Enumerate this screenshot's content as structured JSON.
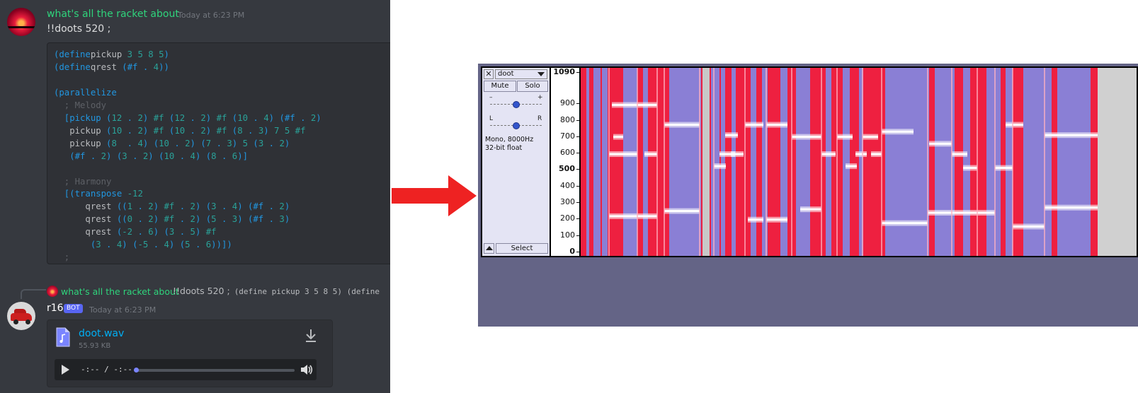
{
  "discord": {
    "message1": {
      "username": "what's all the racket about",
      "timestamp": "Today at 6:23 PM",
      "text": "!!doots 520 ;",
      "code_lines": [
        [
          [
            "kw",
            "(define"
          ],
          [
            "",
            "pickup "
          ],
          [
            "nm",
            "3 5 8 5"
          ],
          [
            "kw",
            ")"
          ]
        ],
        [
          [
            "kw",
            "(define"
          ],
          [
            "",
            "qrest "
          ],
          [
            "kw",
            "(#f . "
          ],
          [
            "nm",
            "4"
          ],
          [
            "kw",
            "))"
          ]
        ],
        [],
        [
          [
            "kw",
            "(parallelize"
          ]
        ],
        [
          [
            "cm",
            "  ; Melody"
          ]
        ],
        [
          [
            "kw",
            "  [pickup "
          ],
          [
            "kw",
            "("
          ],
          [
            "nm",
            "12"
          ],
          [
            "kw",
            " . "
          ],
          [
            "nm",
            "2"
          ],
          [
            "kw",
            ") "
          ],
          [
            "nm",
            "#f "
          ],
          [
            "kw",
            "("
          ],
          [
            "nm",
            "12"
          ],
          [
            "kw",
            " . "
          ],
          [
            "nm",
            "2"
          ],
          [
            "kw",
            ") "
          ],
          [
            "nm",
            "#f "
          ],
          [
            "kw",
            "("
          ],
          [
            "nm",
            "10"
          ],
          [
            "kw",
            " . "
          ],
          [
            "nm",
            "4"
          ],
          [
            "kw",
            ") "
          ],
          [
            "kw",
            "(#f . "
          ],
          [
            "nm",
            "2"
          ],
          [
            "kw",
            ")"
          ]
        ],
        [
          [
            "",
            "   pickup "
          ],
          [
            "kw",
            "("
          ],
          [
            "nm",
            "10"
          ],
          [
            "kw",
            " . "
          ],
          [
            "nm",
            "2"
          ],
          [
            "kw",
            ") "
          ],
          [
            "nm",
            "#f "
          ],
          [
            "kw",
            "("
          ],
          [
            "nm",
            "10"
          ],
          [
            "kw",
            " . "
          ],
          [
            "nm",
            "2"
          ],
          [
            "kw",
            ") "
          ],
          [
            "nm",
            "#f "
          ],
          [
            "kw",
            "("
          ],
          [
            "nm",
            "8"
          ],
          [
            "kw",
            " . "
          ],
          [
            "nm",
            "3"
          ],
          [
            "kw",
            ") "
          ],
          [
            "nm",
            "7 5 #f"
          ]
        ],
        [
          [
            "",
            "   pickup "
          ],
          [
            "kw",
            "("
          ],
          [
            "nm",
            "8"
          ],
          [
            "kw",
            "  . "
          ],
          [
            "nm",
            "4"
          ],
          [
            "kw",
            ") "
          ],
          [
            "kw",
            "("
          ],
          [
            "nm",
            "10"
          ],
          [
            "kw",
            " . "
          ],
          [
            "nm",
            "2"
          ],
          [
            "kw",
            ") "
          ],
          [
            "kw",
            "("
          ],
          [
            "nm",
            "7"
          ],
          [
            "kw",
            " . "
          ],
          [
            "nm",
            "3"
          ],
          [
            "kw",
            ") "
          ],
          [
            "nm",
            "5 "
          ],
          [
            "kw",
            "("
          ],
          [
            "nm",
            "3"
          ],
          [
            "kw",
            " . "
          ],
          [
            "nm",
            "2"
          ],
          [
            "kw",
            ")"
          ]
        ],
        [
          [
            "kw",
            "   (#f . "
          ],
          [
            "nm",
            "2"
          ],
          [
            "kw",
            ") "
          ],
          [
            "kw",
            "("
          ],
          [
            "nm",
            "3"
          ],
          [
            "kw",
            " . "
          ],
          [
            "nm",
            "2"
          ],
          [
            "kw",
            ") "
          ],
          [
            "kw",
            "("
          ],
          [
            "nm",
            "10"
          ],
          [
            "kw",
            " . "
          ],
          [
            "nm",
            "4"
          ],
          [
            "kw",
            ") "
          ],
          [
            "kw",
            "("
          ],
          [
            "nm",
            "8"
          ],
          [
            "kw",
            " . "
          ],
          [
            "nm",
            "6"
          ],
          [
            "kw",
            ")]"
          ]
        ],
        [],
        [
          [
            "cm",
            "  ; Harmony"
          ]
        ],
        [
          [
            "kw",
            "  [(transpose "
          ],
          [
            "nm",
            "-12"
          ]
        ],
        [
          [
            "",
            "      qrest "
          ],
          [
            "kw",
            "(("
          ],
          [
            "nm",
            "1"
          ],
          [
            "kw",
            " . "
          ],
          [
            "nm",
            "2"
          ],
          [
            "kw",
            ") "
          ],
          [
            "nm",
            "#f "
          ],
          [
            "kw",
            "."
          ],
          [
            "nm",
            " 2"
          ],
          [
            "kw",
            ") "
          ],
          [
            "kw",
            "("
          ],
          [
            "nm",
            "3"
          ],
          [
            "kw",
            " . "
          ],
          [
            "nm",
            "4"
          ],
          [
            "kw",
            ") "
          ],
          [
            "kw",
            "(#f . "
          ],
          [
            "nm",
            "2"
          ],
          [
            "kw",
            ")"
          ]
        ],
        [
          [
            "",
            "      qrest "
          ],
          [
            "kw",
            "(("
          ],
          [
            "nm",
            "0"
          ],
          [
            "kw",
            " . "
          ],
          [
            "nm",
            "2"
          ],
          [
            "kw",
            ") "
          ],
          [
            "nm",
            "#f "
          ],
          [
            "kw",
            "."
          ],
          [
            "nm",
            " 2"
          ],
          [
            "kw",
            ") "
          ],
          [
            "kw",
            "("
          ],
          [
            "nm",
            "5"
          ],
          [
            "kw",
            " . "
          ],
          [
            "nm",
            "3"
          ],
          [
            "kw",
            ") "
          ],
          [
            "kw",
            "(#f . "
          ],
          [
            "nm",
            "3"
          ],
          [
            "kw",
            ")"
          ]
        ],
        [
          [
            "",
            "      qrest "
          ],
          [
            "kw",
            "("
          ],
          [
            "nm",
            "-2"
          ],
          [
            "kw",
            " . "
          ],
          [
            "nm",
            "6"
          ],
          [
            "kw",
            ") "
          ],
          [
            "kw",
            "("
          ],
          [
            "nm",
            "3"
          ],
          [
            "kw",
            " . "
          ],
          [
            "nm",
            "5"
          ],
          [
            "kw",
            ") "
          ],
          [
            "nm",
            "#f"
          ]
        ],
        [
          [
            "kw",
            "       ("
          ],
          [
            "nm",
            "3"
          ],
          [
            "kw",
            " . "
          ],
          [
            "nm",
            "4"
          ],
          [
            "kw",
            ") "
          ],
          [
            "kw",
            "("
          ],
          [
            "nm",
            "-5"
          ],
          [
            "kw",
            " . "
          ],
          [
            "nm",
            "4"
          ],
          [
            "kw",
            ") "
          ],
          [
            "kw",
            "("
          ],
          [
            "nm",
            "5"
          ],
          [
            "kw",
            " . "
          ],
          [
            "nm",
            "6"
          ],
          [
            "kw",
            "))])"
          ]
        ],
        [
          [
            "cm",
            "  ;"
          ]
        ]
      ]
    },
    "reply": {
      "username": "what's all the racket about",
      "preview_text": "!!doots 520 ;",
      "preview_code": "(define pickup 3 5 8 5) (define"
    },
    "message2": {
      "username": "r16",
      "badge": "BOT",
      "timestamp": "Today at 6:23 PM",
      "attachment": {
        "filename": "doot.wav",
        "size": "55.93 KB",
        "time": "-:-- / -:--",
        "progress": 0
      }
    }
  },
  "audacity": {
    "track": {
      "close_label": "✕",
      "name": "doot",
      "mute_label": "Mute",
      "solo_label": "Solo",
      "gain_minus": "–",
      "gain_plus": "+",
      "pan_left": "L",
      "pan_right": "R",
      "info": "Mono, 8000Hz\n32-bit float",
      "select_label": "Select"
    },
    "ruler_labels": [
      {
        "text": "1090",
        "bold": true
      },
      {
        "text": "900",
        "bold": false
      },
      {
        "text": "800",
        "bold": false
      },
      {
        "text": "700",
        "bold": false
      },
      {
        "text": "600",
        "bold": false
      },
      {
        "text": "500",
        "bold": true
      },
      {
        "text": "400",
        "bold": false
      },
      {
        "text": "300",
        "bold": false
      },
      {
        "text": "200",
        "bold": false
      },
      {
        "text": "100",
        "bold": false
      },
      {
        "text": "0",
        "bold": true
      }
    ],
    "colors": {
      "spectrogram_bg": "#ee2040",
      "spectrogram_noise": "#7890f0",
      "tone": "#ffffff",
      "arrow": "#ee2222",
      "discord_bg": "#36393f",
      "audacity_bg": "#646486"
    }
  }
}
